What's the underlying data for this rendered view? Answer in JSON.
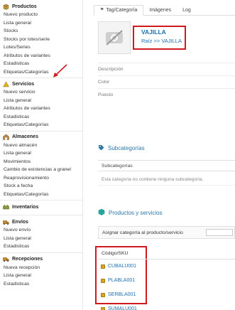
{
  "sidebar": {
    "sections": [
      {
        "title": "Productos",
        "icon": "box-icon",
        "items": [
          "Nuevo producto",
          "Lista general",
          "Stocks",
          "Stocks por lotes/serie",
          "Lotes/Series",
          "Atributos de variantes",
          "Estadisticas",
          "Etiquetas/Categorías"
        ]
      },
      {
        "title": "Servicios",
        "icon": "warning-icon",
        "items": [
          "Nuevo servicio",
          "Lista general",
          "Atributos de variantes",
          "Estadisticas",
          "Etiquetas/Categorías"
        ]
      },
      {
        "title": "Almacenes",
        "icon": "warehouse-icon",
        "items": [
          "Nuevo almacén",
          "Lista general",
          "Movimientos",
          "Cambio de existencias a granel",
          "Reaprovisionamiento",
          "Stock a fecha",
          "Etiquetas/Categorías"
        ]
      },
      {
        "title": "Inventarios",
        "icon": "inventory-icon",
        "items": []
      },
      {
        "title": "Envíos",
        "icon": "truck-icon",
        "items": [
          "Nuevo envío",
          "Lista general",
          "Estadisticas"
        ]
      },
      {
        "title": "Recepciones",
        "icon": "receipt-icon",
        "items": [
          "Nueva recepción",
          "Lista general",
          "Estadisticas"
        ]
      }
    ]
  },
  "tabs": [
    "Tag/Categoría",
    "Imágenes",
    "Log"
  ],
  "category": {
    "title": "VAJILLA",
    "breadcrumb": "Raíz >> VAJILLA"
  },
  "fields": [
    "Descripción",
    "Color",
    "Puesto"
  ],
  "subcategories": {
    "title": "Subcategorías",
    "header": "Subcategorías",
    "empty": "Esta categoría no contiene ninguna subcategoría."
  },
  "products": {
    "title": "Productos y servicios",
    "assign_label": "Asignar categoría al producto/servicio",
    "sku_header": "Código/SKU",
    "rows": [
      "CUBALU001",
      "PLABLA001",
      "SERBLA001",
      "SUMALU001"
    ]
  },
  "colors": {
    "accent": "#1a6fb0",
    "highlight": "#d0191f"
  }
}
